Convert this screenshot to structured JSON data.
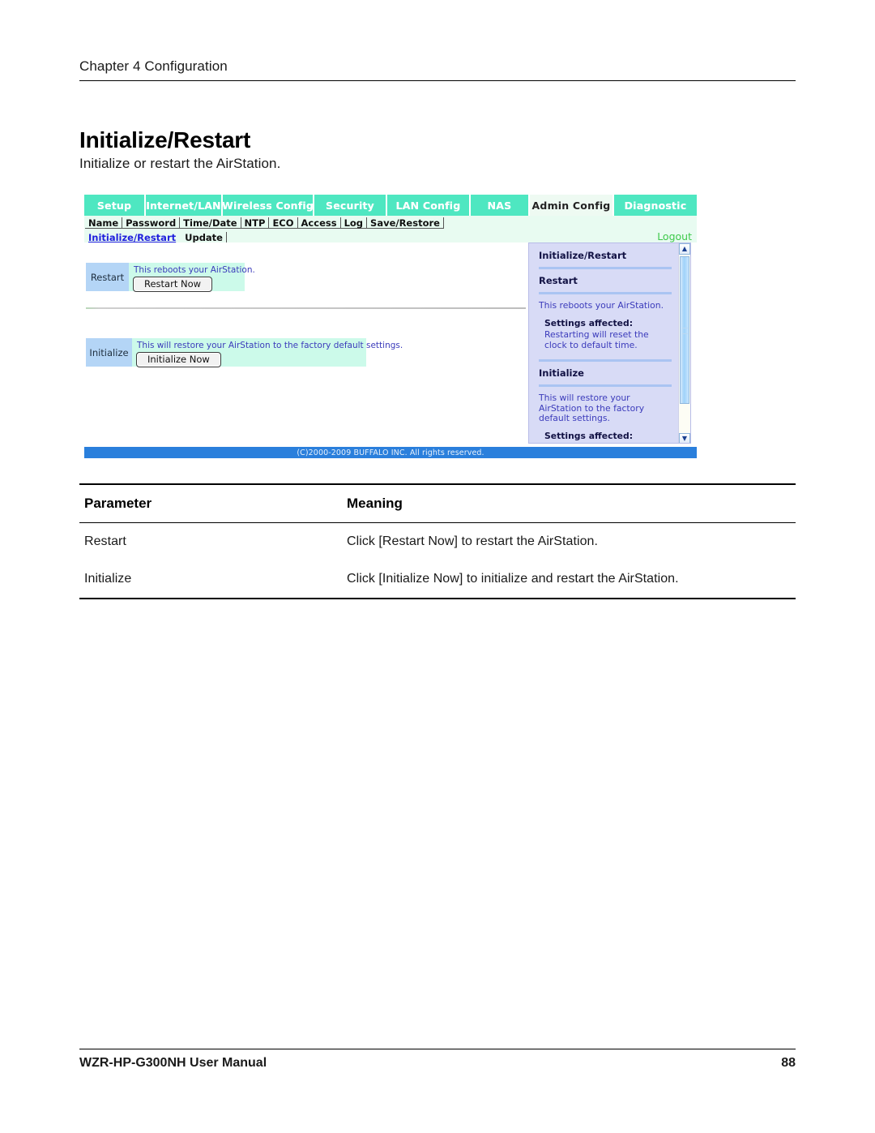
{
  "page": {
    "chapter": "Chapter 4   Configuration",
    "title": "Initialize/Restart",
    "intro": "Initialize or restart the AirStation.",
    "footer_left": "WZR-HP-G300NH User Manual",
    "footer_page": "88"
  },
  "screenshot": {
    "main_tabs": [
      {
        "label": "Setup",
        "active": false
      },
      {
        "label": "Internet/LAN",
        "active": false
      },
      {
        "label": "Wireless Config",
        "active": false
      },
      {
        "label": "Security",
        "active": false
      },
      {
        "label": "LAN Config",
        "active": false
      },
      {
        "label": "NAS",
        "active": false
      },
      {
        "label": "Admin Config",
        "active": true
      },
      {
        "label": "Diagnostic",
        "active": false
      }
    ],
    "sub_tabs_row1": [
      "Name",
      "Password",
      "Time/Date",
      "NTP",
      "ECO",
      "Access",
      "Log",
      "Save/Restore"
    ],
    "sub_tabs_row2": [
      "Initialize/Restart",
      "Update"
    ],
    "sub_tab_current": "Initialize/Restart",
    "logout_label": "Logout",
    "rows": [
      {
        "label": "Restart",
        "note": "This reboots your AirStation.",
        "button": "Restart Now"
      },
      {
        "label": "Initialize",
        "note": "This will restore your AirStation to the factory default settings.",
        "button": "Initialize Now"
      }
    ],
    "help_panel": {
      "title": "Initialize/Restart",
      "sections": [
        {
          "heading": "Restart",
          "body": "This reboots your AirStation.",
          "affected_label": "Settings affected:",
          "affected_body": "Restarting will reset the clock to default time."
        },
        {
          "heading": "Initialize",
          "body": "This will restore your AirStation to the factory default settings.",
          "affected_label": "Settings affected:",
          "affected_body": ""
        }
      ]
    },
    "copyright": "(C)2000-2009 BUFFALO INC. All rights reserved.",
    "colors": {
      "tab_teal": "#4ee7c1",
      "tab_active_bg": "#eefaf2",
      "subnav_bg": "#e8fbf1",
      "label_cell": "#b4d5f6",
      "field_cell": "#ccfaea",
      "help_bg": "#d8dbf6",
      "footer_blue": "#2a7fdc",
      "link_blue": "#2020dd",
      "logout_green": "#3ec94b"
    }
  },
  "table": {
    "headers": [
      "Parameter",
      "Meaning"
    ],
    "rows": [
      {
        "parameter": "Restart",
        "meaning": "Click [Restart Now] to restart the AirStation."
      },
      {
        "parameter": "Initialize",
        "meaning": "Click [Initialize Now] to initialize and restart the AirStation."
      }
    ]
  }
}
